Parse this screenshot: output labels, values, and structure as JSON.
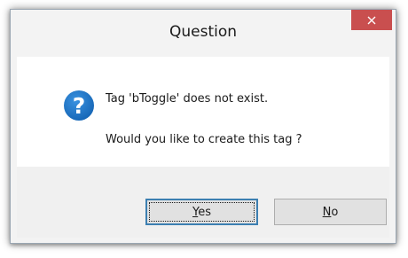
{
  "dialog": {
    "title": "Question",
    "message_line1": "Tag 'bToggle' does not exist.",
    "message_line2": "Would you like to create this tag ?",
    "icon": "question-icon"
  },
  "buttons": {
    "yes": {
      "mnemonic": "Y",
      "rest": "es"
    },
    "no": {
      "mnemonic": "N",
      "rest": "o"
    }
  },
  "title_bar": {
    "close_icon": "close-icon"
  },
  "colors": {
    "close_button_bg": "#c94f4f",
    "question_icon_bg": "#1f74c4",
    "window_bg": "#f3f3f3",
    "button_bg": "#e1e1e1",
    "default_button_border": "#3c7fb1"
  }
}
